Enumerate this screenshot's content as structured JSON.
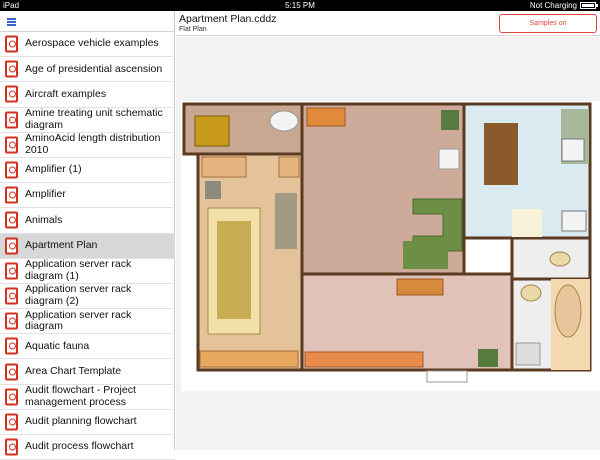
{
  "status_bar": {
    "device": "iPad",
    "time": "5:15 PM",
    "charging": "Not Charging",
    "wifi_icon": "wifi-icon",
    "battery_icon": "battery-icon"
  },
  "sidebar": {
    "menu_icon": "hamburger-menu-icon",
    "items": [
      {
        "label": "Aerospace vehicle examples"
      },
      {
        "label": "Age of presidential ascension"
      },
      {
        "label": "Aircraft examples"
      },
      {
        "label": "Amine treating unit schematic diagram"
      },
      {
        "label": "AminoAcid length distribution 2010"
      },
      {
        "label": "Amplifier (1)"
      },
      {
        "label": "Amplifier"
      },
      {
        "label": "Animals"
      },
      {
        "label": "Apartment Plan",
        "selected": true
      },
      {
        "label": "Application server rack diagram (1)"
      },
      {
        "label": "Application server rack diagram (2)"
      },
      {
        "label": "Application server rack diagram"
      },
      {
        "label": "Aquatic fauna"
      },
      {
        "label": "Area Chart Template"
      },
      {
        "label": "Audit flowchart - Project management process"
      },
      {
        "label": "Audit planning flowchart"
      },
      {
        "label": "Audit process flowchart"
      }
    ]
  },
  "header": {
    "title": "Apartment Plan.cddz",
    "subtitle": "Flat Plan",
    "samples_button": "Samples on ConceptDraw.com"
  },
  "colors": {
    "accent": "#e0463c",
    "menu_blue": "#3565d0",
    "doc_icon_red": "#d2311f",
    "selected_row": "#d7d7d7"
  }
}
